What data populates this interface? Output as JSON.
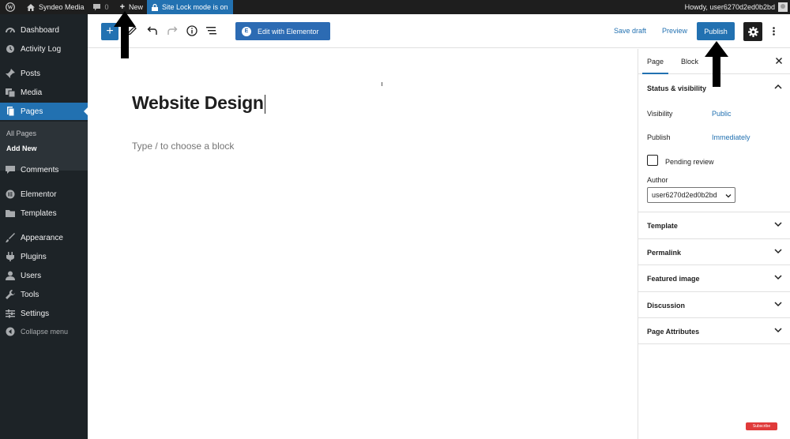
{
  "admin_bar": {
    "site_name": "Syndeo Media",
    "comments_count": "0",
    "new_label": "New",
    "sitelock_label": "Site Lock mode is on",
    "howdy": "Howdy, user6270d2ed0b2bd"
  },
  "sidebar": {
    "items": [
      {
        "label": "Dashboard",
        "icon": "dashboard-icon"
      },
      {
        "label": "Activity Log",
        "icon": "activity-log-icon"
      },
      {
        "label": "Posts",
        "icon": "posts-pin-icon"
      },
      {
        "label": "Media",
        "icon": "media-icon"
      },
      {
        "label": "Pages",
        "icon": "pages-icon"
      },
      {
        "label": "Comments",
        "icon": "comments-icon"
      },
      {
        "label": "Elementor",
        "icon": "elementor-icon"
      },
      {
        "label": "Templates",
        "icon": "templates-folder-icon"
      },
      {
        "label": "Appearance",
        "icon": "appearance-brush-icon"
      },
      {
        "label": "Plugins",
        "icon": "plugins-icon"
      },
      {
        "label": "Users",
        "icon": "users-icon"
      },
      {
        "label": "Tools",
        "icon": "tools-wrench-icon"
      },
      {
        "label": "Settings",
        "icon": "settings-icon"
      }
    ],
    "submenu": [
      "All Pages",
      "Add New"
    ],
    "collapse_label": "Collapse menu"
  },
  "toolbar": {
    "elementor_label": "Edit with Elementor",
    "save_draft": "Save draft",
    "preview": "Preview",
    "publish": "Publish"
  },
  "editor": {
    "title": "Website Design",
    "block_placeholder": "Type / to choose a block"
  },
  "panel": {
    "tabs": [
      "Page",
      "Block"
    ],
    "status_visibility": "Status & visibility",
    "visibility_label": "Visibility",
    "visibility_value": "Public",
    "publish_label": "Publish",
    "publish_value": "Immediately",
    "pending_review": "Pending review",
    "author_label": "Author",
    "author_value": "user6270d2ed0b2bd",
    "sections": [
      "Template",
      "Permalink",
      "Featured image",
      "Discussion",
      "Page Attributes"
    ]
  },
  "colors": {
    "accent": "#2271b1",
    "admin_dark": "#1d2327"
  },
  "badge": {
    "text": "Subscribe"
  }
}
